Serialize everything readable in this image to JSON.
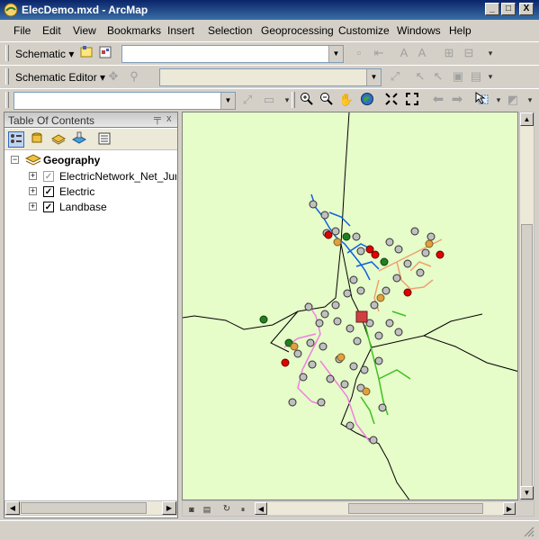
{
  "window": {
    "title": "ElecDemo.mxd - ArcMap",
    "controls": {
      "minimize": "_",
      "maximize": "□",
      "close": "X"
    }
  },
  "menubar": {
    "items": [
      "File",
      "Edit",
      "View",
      "Bookmarks",
      "Insert",
      "Selection",
      "Geoprocessing",
      "Customize",
      "Windows",
      "Help"
    ]
  },
  "toolbars": {
    "schematic": {
      "label": "Schematic ▾",
      "combo_value": ""
    },
    "schematic_editor": {
      "label": "Schematic Editor ▾",
      "combo_value": ""
    },
    "layer_combo_value": ""
  },
  "toc": {
    "title": "Table Of Contents",
    "pin": "ᵖ",
    "close": "x",
    "tree": {
      "group": {
        "name": "Geography",
        "expanded": true
      },
      "layers": [
        {
          "name": "ElectricNetwork_Net_Junct",
          "checked": true,
          "disabled": true
        },
        {
          "name": "Electric",
          "checked": true,
          "disabled": false
        },
        {
          "name": "Landbase",
          "checked": true,
          "disabled": false
        }
      ]
    }
  },
  "colors": {
    "map_background": "#e6fcc9",
    "feeder_blue": "#1060e0",
    "feeder_orange": "#f0a070",
    "feeder_pink": "#f080e0",
    "feeder_green": "#40c020",
    "junction_gray": "#c0c0c0",
    "device_red": "#e00000",
    "device_green": "#208020",
    "boundary": "#000000"
  },
  "icons": {
    "app": "globe-map-icon",
    "toc_tools": [
      "list-by-drawing-order-icon",
      "list-by-source-icon",
      "list-by-visibility-icon",
      "list-by-selection-icon",
      "options-icon"
    ],
    "nav_tools": [
      "zoom-in-icon",
      "zoom-out-icon",
      "pan-icon",
      "full-extent-icon",
      "fixed-zoom-in-icon",
      "fixed-zoom-out-icon",
      "back-icon",
      "forward-icon",
      "select-icon"
    ]
  }
}
